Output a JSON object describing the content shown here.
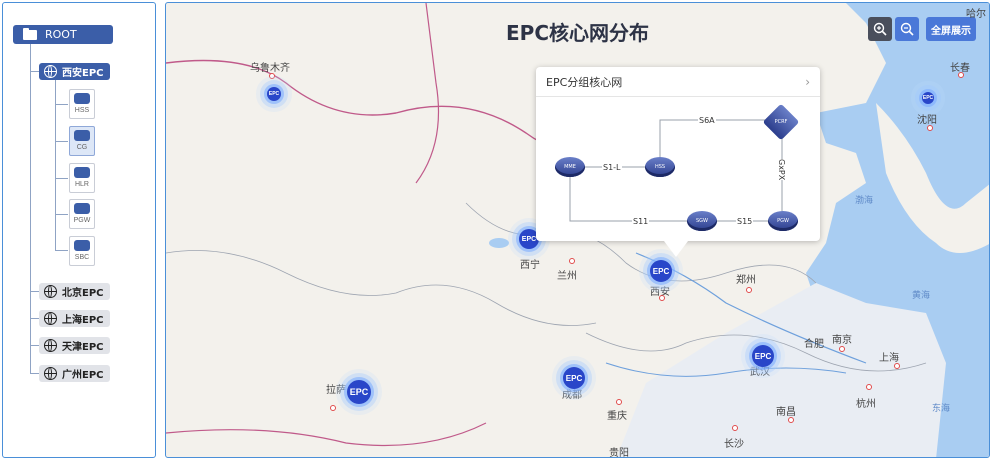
{
  "sidebar": {
    "root_label": "ROOT",
    "epc_groups": [
      {
        "label": "西安EPC",
        "active": true
      },
      {
        "label": "北京EPC",
        "active": false
      },
      {
        "label": "上海EPC",
        "active": false
      },
      {
        "label": "天津EPC",
        "active": false
      },
      {
        "label": "广州EPC",
        "active": false
      }
    ],
    "devices": [
      {
        "label": "HSS",
        "icon": "hss-icon",
        "selected": false
      },
      {
        "label": "CG",
        "icon": "cg-icon",
        "selected": true
      },
      {
        "label": "HLR",
        "icon": "hlr-icon",
        "selected": false
      },
      {
        "label": "PGW",
        "icon": "pgw-icon",
        "selected": false
      },
      {
        "label": "SBC",
        "icon": "sbc-icon",
        "selected": false
      }
    ]
  },
  "map": {
    "title": "EPC核心网分布",
    "zoom_in_icon": "zoom-in-icon",
    "zoom_out_icon": "zoom-out-icon",
    "fullscreen_label": "全屏展示",
    "cities": [
      "哈尔",
      "长春",
      "沈阳",
      "乌鲁木齐",
      "西宁",
      "兰州",
      "西安",
      "郑州",
      "合肥",
      "南京",
      "上海",
      "杭州",
      "武汉",
      "南昌",
      "长沙",
      "成都",
      "重庆",
      "拉萨",
      "贵阳"
    ],
    "seas": [
      "渤海",
      "黄海",
      "东海"
    ],
    "epc_marker_label": "EPC"
  },
  "popup": {
    "title": "EPC分组核心网",
    "links": [
      "S1-L",
      "S6A",
      "S11",
      "S15",
      "GxPX"
    ],
    "nodes": [
      "MME",
      "HSS",
      "PCRF",
      "SGW",
      "PGW"
    ]
  },
  "colors": {
    "accent": "#3b5ea8",
    "marker": "#2946c9",
    "button": "#4a78d8"
  }
}
